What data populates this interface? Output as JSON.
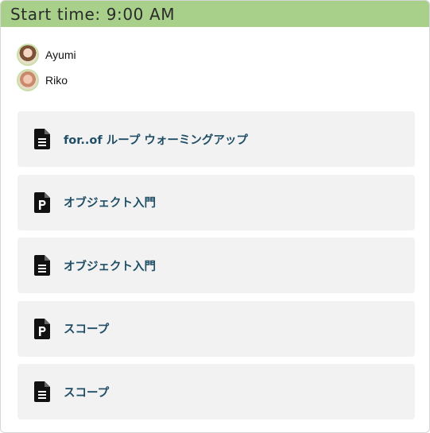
{
  "header": {
    "title": "Start time: 9:00 AM",
    "color": "#a8d08a"
  },
  "members": [
    {
      "name": "Ayumi"
    },
    {
      "name": "Riko"
    }
  ],
  "items": [
    {
      "label": "for..of ループ ウォーミングアップ",
      "icon": "document-lines-icon"
    },
    {
      "label": "オブジェクト入門",
      "icon": "document-p-icon"
    },
    {
      "label": "オブジェクト入門",
      "icon": "document-lines-icon"
    },
    {
      "label": "スコープ",
      "icon": "document-p-icon"
    },
    {
      "label": "スコープ",
      "icon": "document-lines-icon"
    }
  ]
}
